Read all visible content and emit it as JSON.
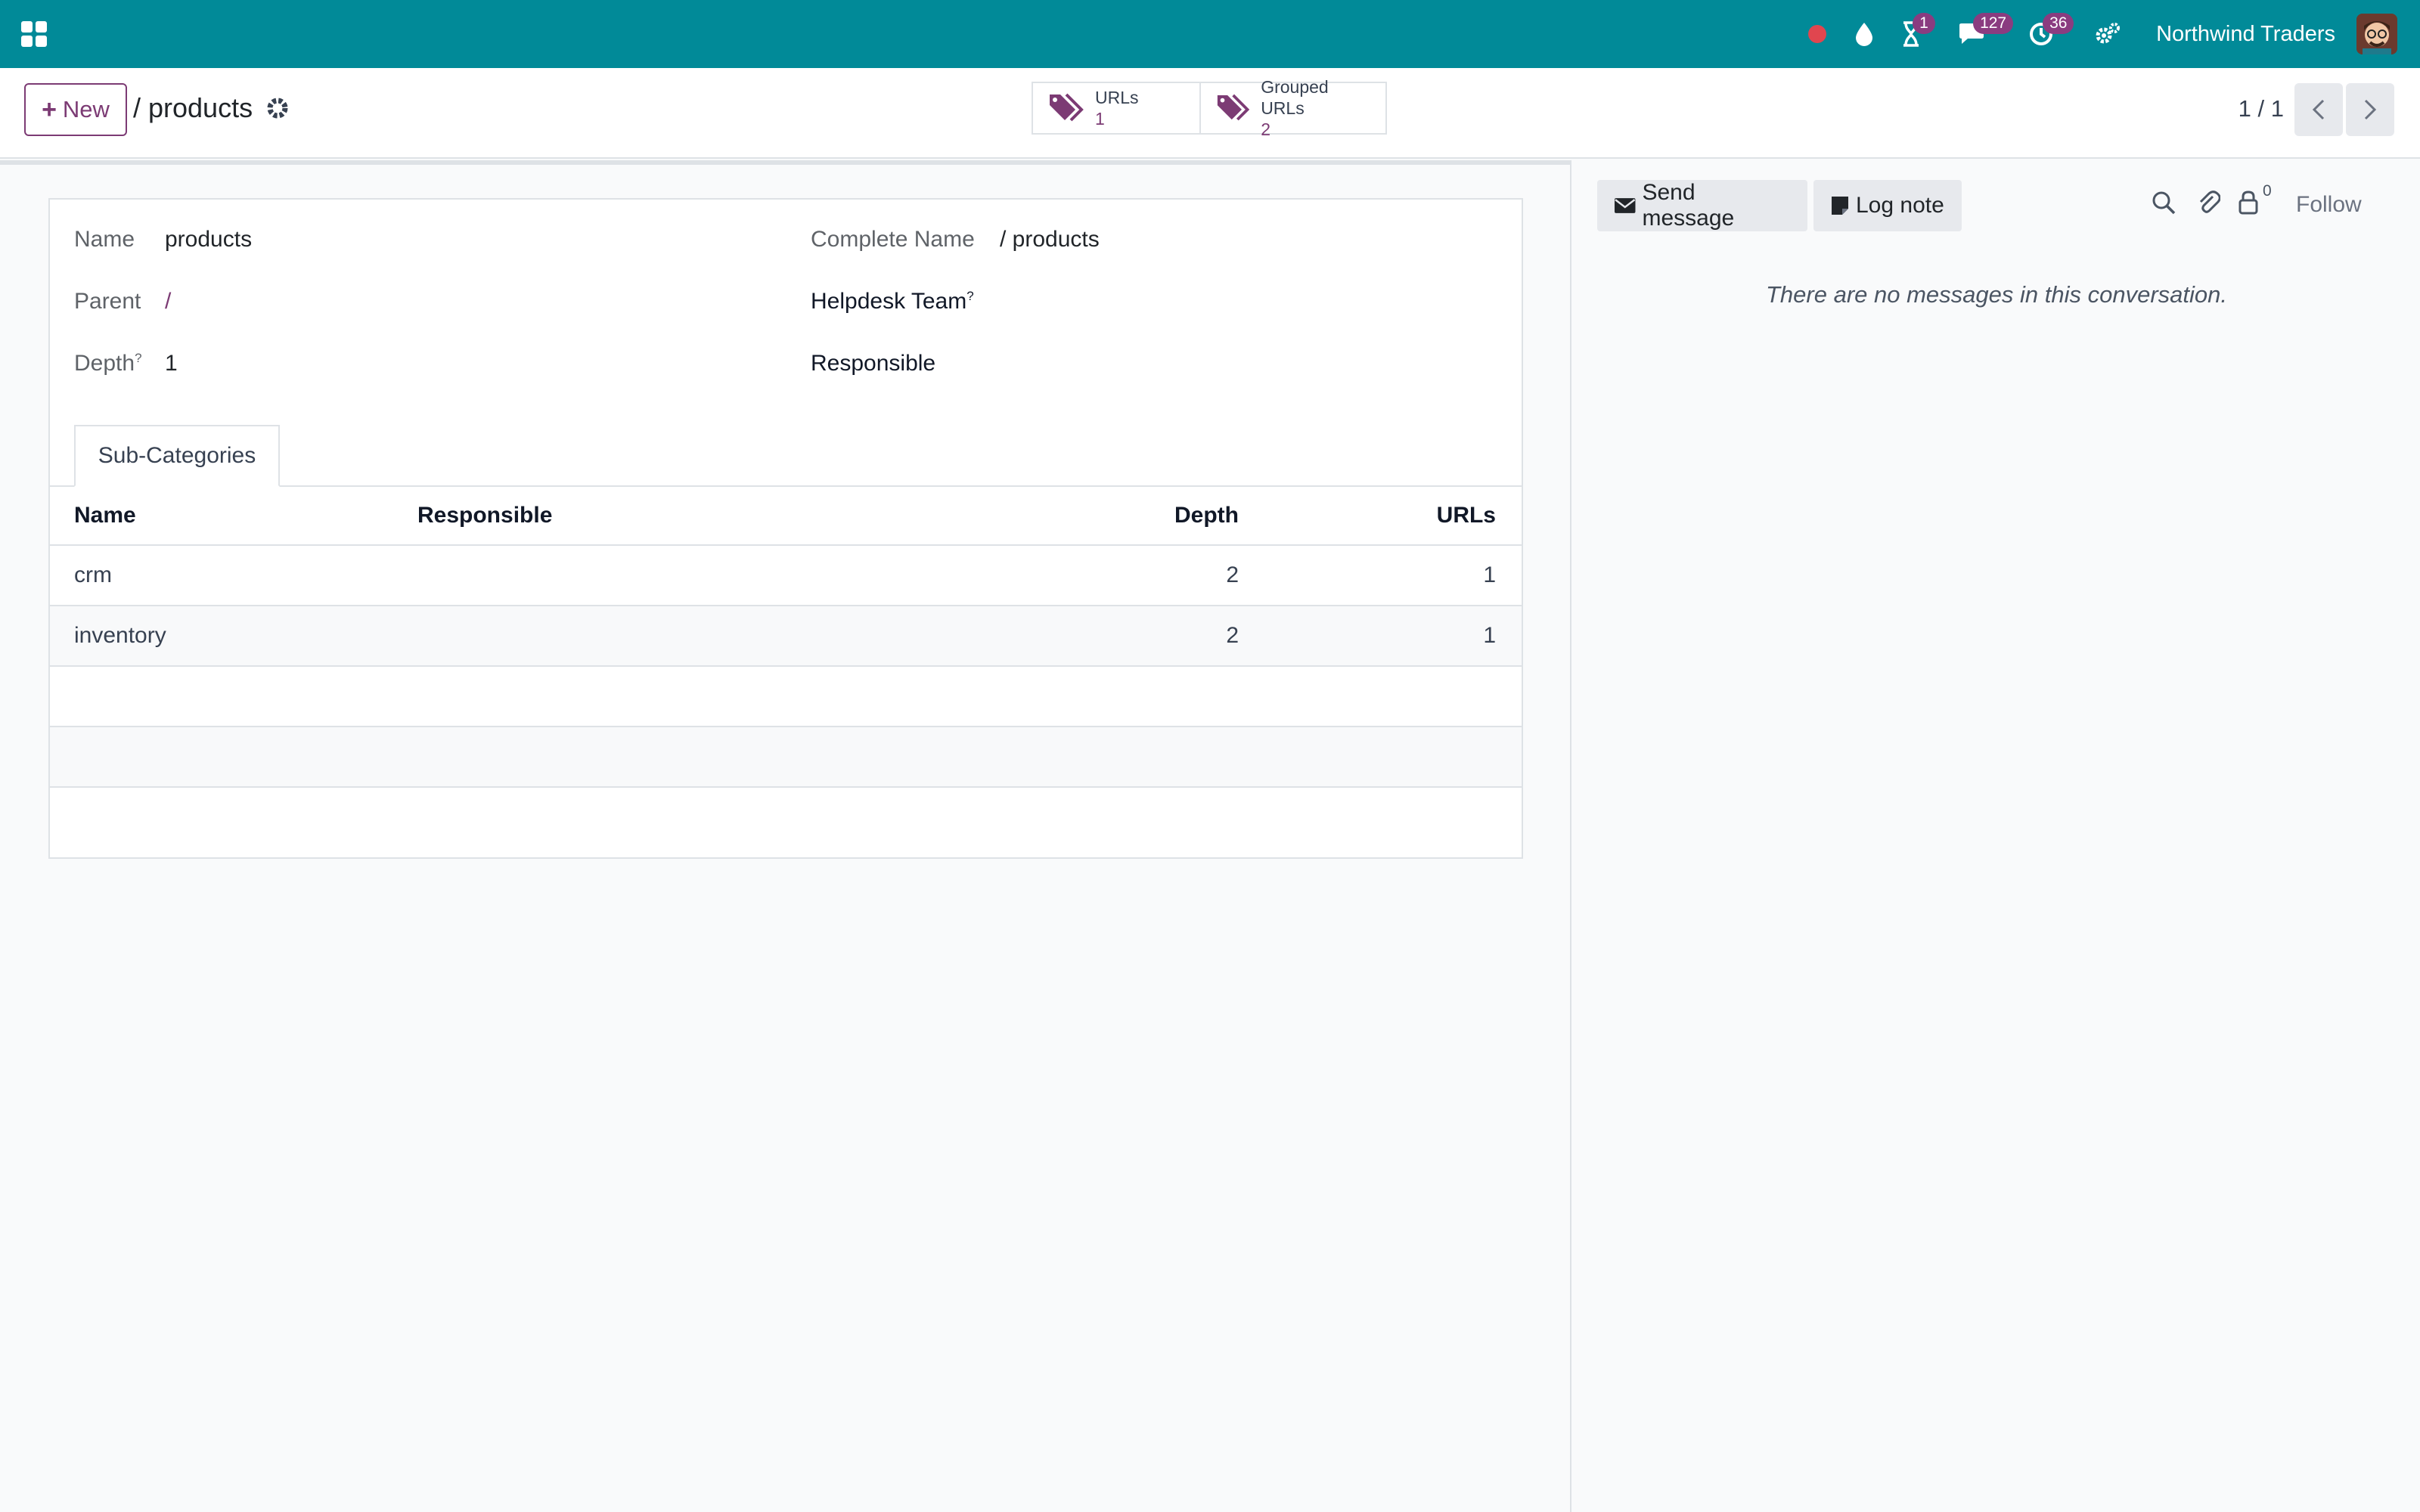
{
  "navbar": {
    "company": "Northwind Traders",
    "badges": {
      "activities": "1",
      "messages": "127",
      "timesheets": "36"
    },
    "colors": {
      "bar": "#018a98",
      "badge": "#8a3c80",
      "recording": "#e0464f"
    }
  },
  "control_panel": {
    "new_label": "New",
    "breadcrumb": "/ products",
    "smart_buttons": [
      {
        "label": "URLs",
        "value": "1",
        "icon": "tags-icon"
      },
      {
        "label": "Grouped URLs",
        "value": "2",
        "icon": "tags-icon"
      }
    ],
    "pager": "1 / 1"
  },
  "form": {
    "name_label": "Name",
    "name_value": "products",
    "parent_label": "Parent",
    "parent_value": "/",
    "depth_label": "Depth",
    "depth_help": "?",
    "depth_value": "1",
    "complete_name_label": "Complete Name",
    "complete_name_value": "/ products",
    "helpdesk_label": "Helpdesk Team",
    "helpdesk_help": "?",
    "responsible_label": "Responsible",
    "tab_label": "Sub-Categories",
    "table": {
      "columns": [
        "Name",
        "Responsible",
        "Depth",
        "URLs"
      ],
      "rows": [
        {
          "name": "crm",
          "responsible": "",
          "depth": "2",
          "urls": "1"
        },
        {
          "name": "inventory",
          "responsible": "",
          "depth": "2",
          "urls": "1"
        }
      ]
    }
  },
  "chatter": {
    "send_message": "Send message",
    "log_note": "Log note",
    "followers_count": "0",
    "follow": "Follow",
    "empty_text": "There are no messages in this conversation."
  }
}
